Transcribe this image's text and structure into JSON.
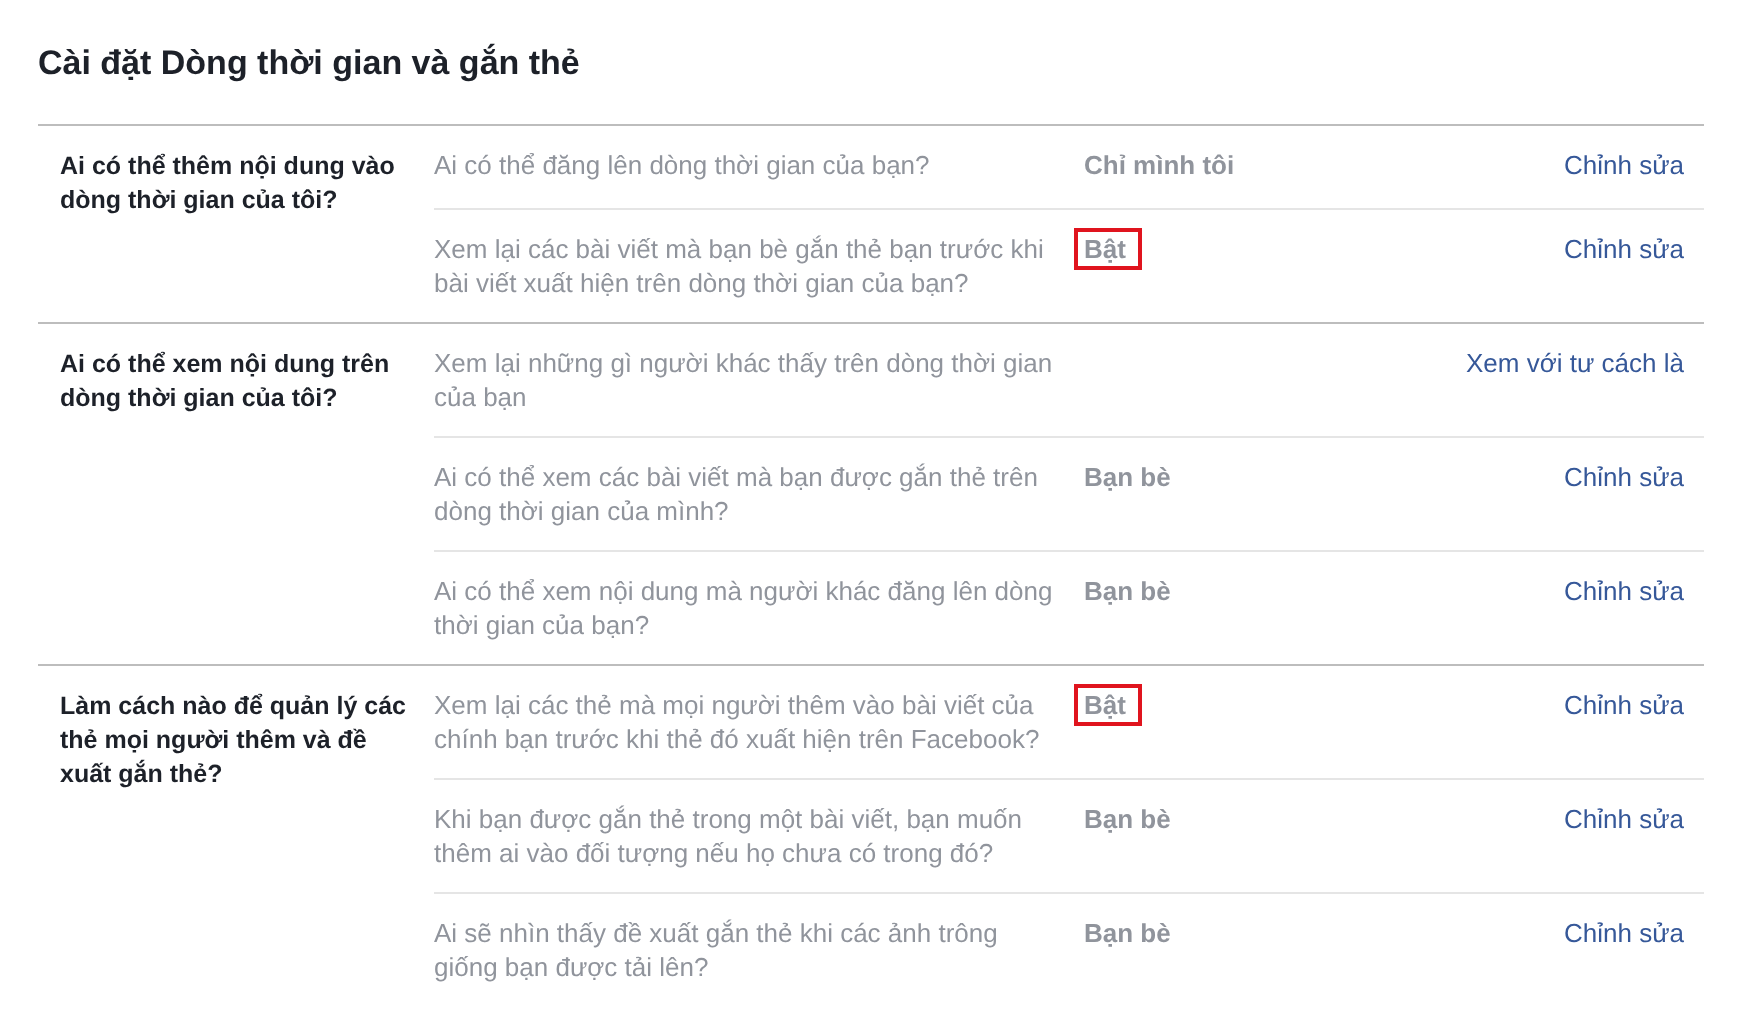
{
  "title": "Cài đặt Dòng thời gian và gắn thẻ",
  "sections": [
    {
      "heading": "Ai có thể thêm nội dung vào dòng thời gian của tôi?",
      "settings": [
        {
          "description": "Ai có thể đăng lên dòng thời gian của bạn?",
          "value": "Chỉ mình tôi",
          "highlighted": false,
          "action": "Chỉnh sửa"
        },
        {
          "description": "Xem lại các bài viết mà bạn bè gắn thẻ bạn trước khi bài viết xuất hiện trên dòng thời gian của bạn?",
          "value": "Bật",
          "highlighted": true,
          "action": "Chỉnh sửa"
        }
      ]
    },
    {
      "heading": "Ai có thể xem nội dung trên dòng thời gian của tôi?",
      "settings": [
        {
          "description": "Xem lại những gì người khác thấy trên dòng thời gian của bạn",
          "action": "Xem với tư cách là"
        },
        {
          "description": "Ai có thể xem các bài viết mà bạn được gắn thẻ trên dòng thời gian của mình?",
          "value": "Bạn bè",
          "highlighted": false,
          "action": "Chỉnh sửa"
        },
        {
          "description": "Ai có thể xem nội dung mà người khác đăng lên dòng thời gian của bạn?",
          "value": "Bạn bè",
          "highlighted": false,
          "action": "Chỉnh sửa"
        }
      ]
    },
    {
      "heading": "Làm cách nào để quản lý các thẻ mọi người thêm và đề xuất gắn thẻ?",
      "settings": [
        {
          "description": "Xem lại các thẻ mà mọi người thêm vào bài viết của chính bạn trước khi thẻ đó xuất hiện trên Facebook?",
          "value": "Bật",
          "highlighted": true,
          "action": "Chỉnh sửa"
        },
        {
          "description": "Khi bạn được gắn thẻ trong một bài viết, bạn muốn thêm ai vào đối tượng nếu họ chưa có trong đó?",
          "value": "Bạn bè",
          "highlighted": false,
          "action": "Chỉnh sửa"
        },
        {
          "description": "Ai sẽ nhìn thấy đề xuất gắn thẻ khi các ảnh trông giống bạn được tải lên?",
          "value": "Bạn bè",
          "highlighted": false,
          "action": "Chỉnh sửa"
        }
      ]
    }
  ]
}
